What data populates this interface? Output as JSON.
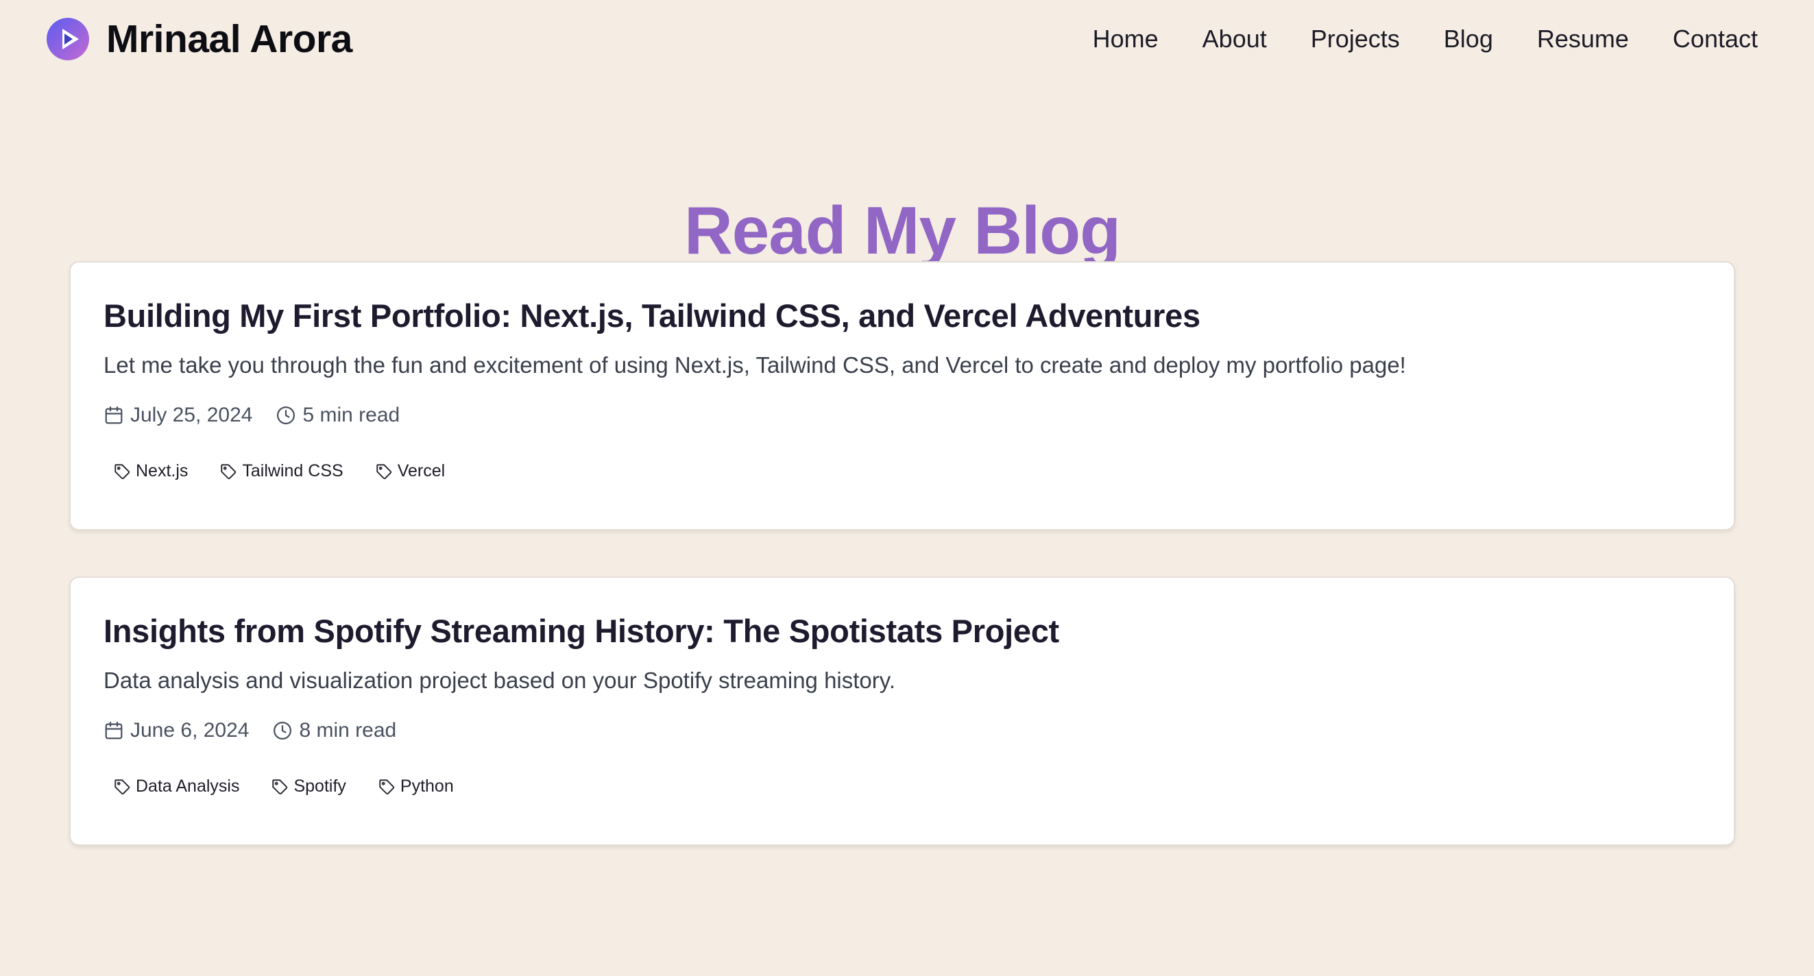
{
  "header": {
    "brand_name": "Mrinaal Arora",
    "logo_icon": "play-circle-logo-icon",
    "nav": [
      {
        "label": "Home"
      },
      {
        "label": "About"
      },
      {
        "label": "Projects"
      },
      {
        "label": "Blog"
      },
      {
        "label": "Resume"
      },
      {
        "label": "Contact"
      }
    ]
  },
  "main": {
    "title": "Read My Blog",
    "posts": [
      {
        "title": "Building My First Portfolio: Next.js, Tailwind CSS, and Vercel Adventures",
        "description": "Let me take you through the fun and excitement of using Next.js, Tailwind CSS, and Vercel to create and deploy my portfolio page!",
        "date": "July 25, 2024",
        "read_time": "5 min read",
        "tags": [
          "Next.js",
          "Tailwind CSS",
          "Vercel"
        ]
      },
      {
        "title": "Insights from Spotify Streaming History: The Spotistats Project",
        "description": "Data analysis and visualization project based on your Spotify streaming history.",
        "date": "June 6, 2024",
        "read_time": "8 min read",
        "tags": [
          "Data Analysis",
          "Spotify",
          "Python"
        ]
      }
    ]
  },
  "colors": {
    "background": "#f5ede3",
    "title_accent": "#9166c5",
    "card_background": "#ffffff",
    "logo_gradient_start": "#6a5cff",
    "logo_gradient_end": "#c06ad8"
  },
  "icons": {
    "date": "calendar-icon",
    "read_time": "clock-icon",
    "tag": "tag-icon"
  }
}
